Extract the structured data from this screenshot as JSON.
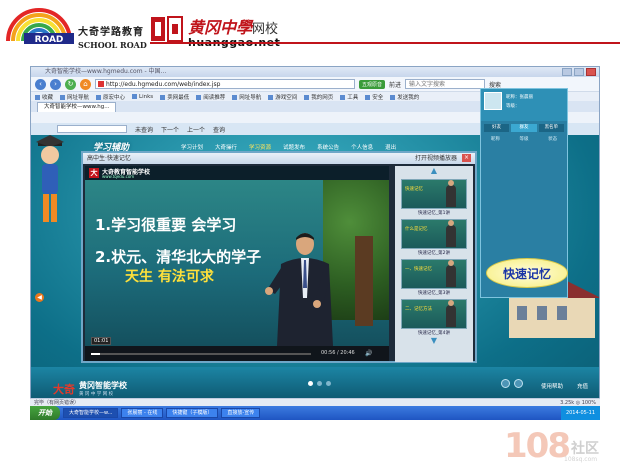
{
  "header": {
    "road_badge": "ROAD",
    "road_cn": "大奇学路教育",
    "road_en": "SCHOOL ROAD",
    "hg_cn": "黄冈中學",
    "hg_cn_suffix": "网校",
    "hg_en": "huanggao.net"
  },
  "browser": {
    "title": "大奇智能学校—www.hgmedu.com - 中国...",
    "address": "http://edu.hgmedu.com/web/index.jsp",
    "badge": "五观原音",
    "search_placeholder": "输入文字搜索",
    "nav_btn_go": "前进",
    "search_btn": "搜索",
    "bookmarks": [
      "收藏",
      "网址导航",
      "原宏中心",
      "Links",
      "卖网最低",
      "阅读推荐",
      "网址导航",
      "游戏空间",
      "我的网页"
    ],
    "tools": [
      "工具",
      "安全",
      "发送我的"
    ],
    "tab": "大奇智能学校—www.hg..."
  },
  "site": {
    "buttons": [
      "未查询",
      "下一个",
      "上一个",
      "查询"
    ],
    "study_title": "学习辅助",
    "menu": [
      "学习计划",
      "大奇操行",
      "学习资源",
      "试题发布",
      "系统公告",
      "个人信息",
      "退出"
    ],
    "menu_active_index": 2,
    "brand_tq": "大奇",
    "brand_name": "黄冈智能学校",
    "brand_en": "黄 冈 中 学 网 校",
    "bottom_links": [
      "使用帮助",
      "充值"
    ]
  },
  "player": {
    "title": "高中生·快速记忆",
    "window_btn": "打开视频播放器",
    "logo_letter": "大",
    "video_brand_cn": "大奇教育智能学校",
    "video_brand_en": "www.tqedu.com",
    "line1": "1.学习很重要    会学习",
    "line2": "2.状元、清华北大的学子",
    "line3": "天生    有法可求",
    "timestamp": "01:01",
    "time": "00:56 / 20:46",
    "progress": 0.04,
    "playlist": [
      {
        "thumb": "快速记忆",
        "caption": "快速记忆_第1讲"
      },
      {
        "thumb": "什么是记忆",
        "caption": "快速记忆_第2讲"
      },
      {
        "thumb": "一、快速记忆",
        "caption": "快速记忆_第3讲"
      },
      {
        "thumb": "二、记忆方法",
        "caption": "快速记忆_第4讲"
      }
    ]
  },
  "profile": {
    "name_label": "昵称：张晨丽",
    "grade_label": "等级：",
    "tabs": [
      "好友",
      "群友",
      "黑名单"
    ],
    "tab_active_index": 1,
    "columns": [
      "昵称",
      "等级",
      "状态"
    ]
  },
  "bubble": "快速记忆",
  "statusbar": {
    "left": "完毕（有网页错误）",
    "right": "3.25k  ◎ 100%"
  },
  "taskbar": {
    "start": "开始",
    "tasks": [
      "大奇智能学校—w...",
      "张晨丽 - 在线",
      "快捷键（子模版）",
      "直接放-宣传"
    ],
    "tray": "2014-05-11"
  },
  "watermark": {
    "num": "108",
    "text": "社区",
    "site": "108sq.com"
  }
}
